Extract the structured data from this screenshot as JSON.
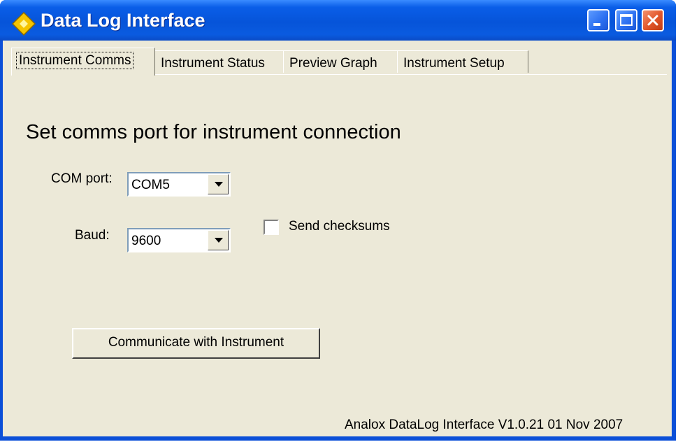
{
  "window": {
    "title": "Data Log Interface",
    "icon": "app-diamond-icon"
  },
  "tabs": [
    {
      "label": "Instrument Comms",
      "active": true
    },
    {
      "label": "Instrument Status",
      "active": false
    },
    {
      "label": "Preview Graph",
      "active": false
    },
    {
      "label": "Instrument Setup",
      "active": false
    }
  ],
  "comms": {
    "heading": "Set comms port for instrument connection",
    "com_port_label": "COM port:",
    "com_port_value": "COM5",
    "baud_label": "Baud:",
    "baud_value": "9600",
    "send_checksums_label": "Send checksums",
    "send_checksums_checked": false,
    "communicate_button": "Communicate with Instrument"
  },
  "version_text": "Analox DataLog Interface V1.0.21 01 Nov 2007",
  "colors": {
    "titlebar": "#0654d9",
    "client_bg": "#ece9d8",
    "close_button": "#e0552a"
  }
}
